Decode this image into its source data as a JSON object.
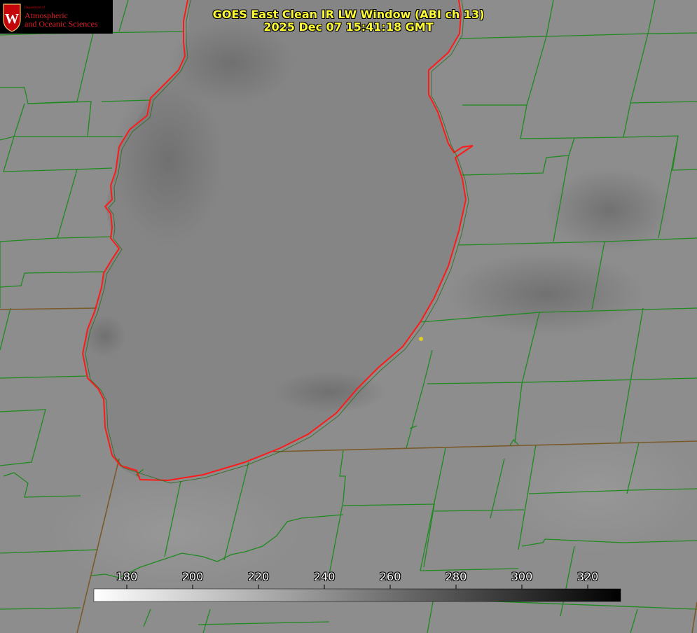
{
  "logo": {
    "dept_small": "Department of",
    "line1": "Atmospheric",
    "line2": "and Oceanic Sciences",
    "seal_letter": "W",
    "seal_color": "#c5050c"
  },
  "title": {
    "line1": "GOES East Clean IR LW Window (ABI ch 13)",
    "line2": "2025 Dec 07 15:41:18 GMT"
  },
  "colorbar": {
    "min": 170,
    "max": 330,
    "ticks": [
      180,
      200,
      220,
      240,
      260,
      280,
      300,
      320
    ],
    "gradient_from": "#ffffff",
    "gradient_to": "#000000"
  },
  "colors": {
    "county_lines": "#1f8a1f",
    "state_lines": "#7a5a2a",
    "shoreline": "#ff1a1a",
    "marker": "#e0d020",
    "title": "#ffff33"
  }
}
